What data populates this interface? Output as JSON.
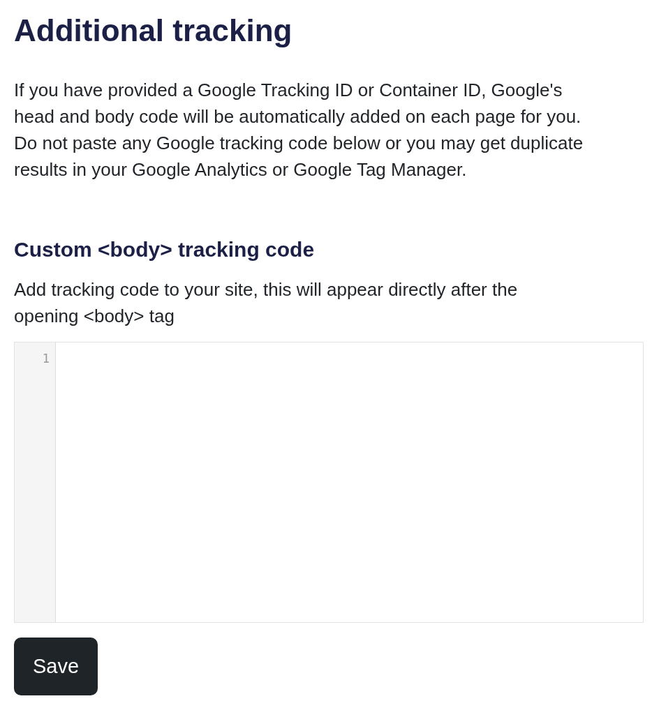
{
  "title": "Additional tracking",
  "intro": "If you have provided a Google Tracking ID or Container ID, Google's head and body code will be automatically added on each page for you. Do not paste any Google tracking code below or you may get duplicate results in your Google Analytics or Google Tag Manager.",
  "section": {
    "heading": "Custom <body> tracking code",
    "description": "Add tracking code to your site, this will appear directly after the opening <body> tag"
  },
  "editor": {
    "line_numbers": [
      "1"
    ]
  },
  "save_button": "Save"
}
